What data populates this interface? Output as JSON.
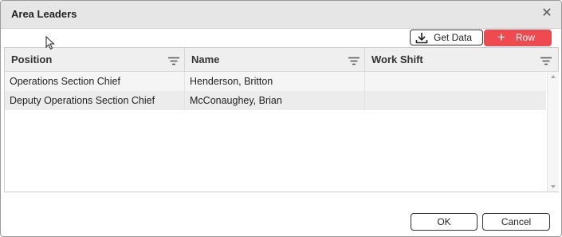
{
  "dialog": {
    "title": "Area Leaders",
    "close_glyph": "✕"
  },
  "toolbar": {
    "get_data_label": "Get Data",
    "get_data_icon": "download-icon",
    "row_label": "Row",
    "row_icon": "plus-icon",
    "accent": "#ef4a4f"
  },
  "grid": {
    "columns": [
      "Position",
      "Name",
      "Work Shift"
    ],
    "rows": [
      [
        "Operations Section Chief",
        "Henderson, Britton",
        ""
      ],
      [
        "Deputy Operations Section Chief",
        "McConaughey, Brian",
        ""
      ]
    ]
  },
  "footer": {
    "ok_label": "OK",
    "cancel_label": "Cancel"
  }
}
